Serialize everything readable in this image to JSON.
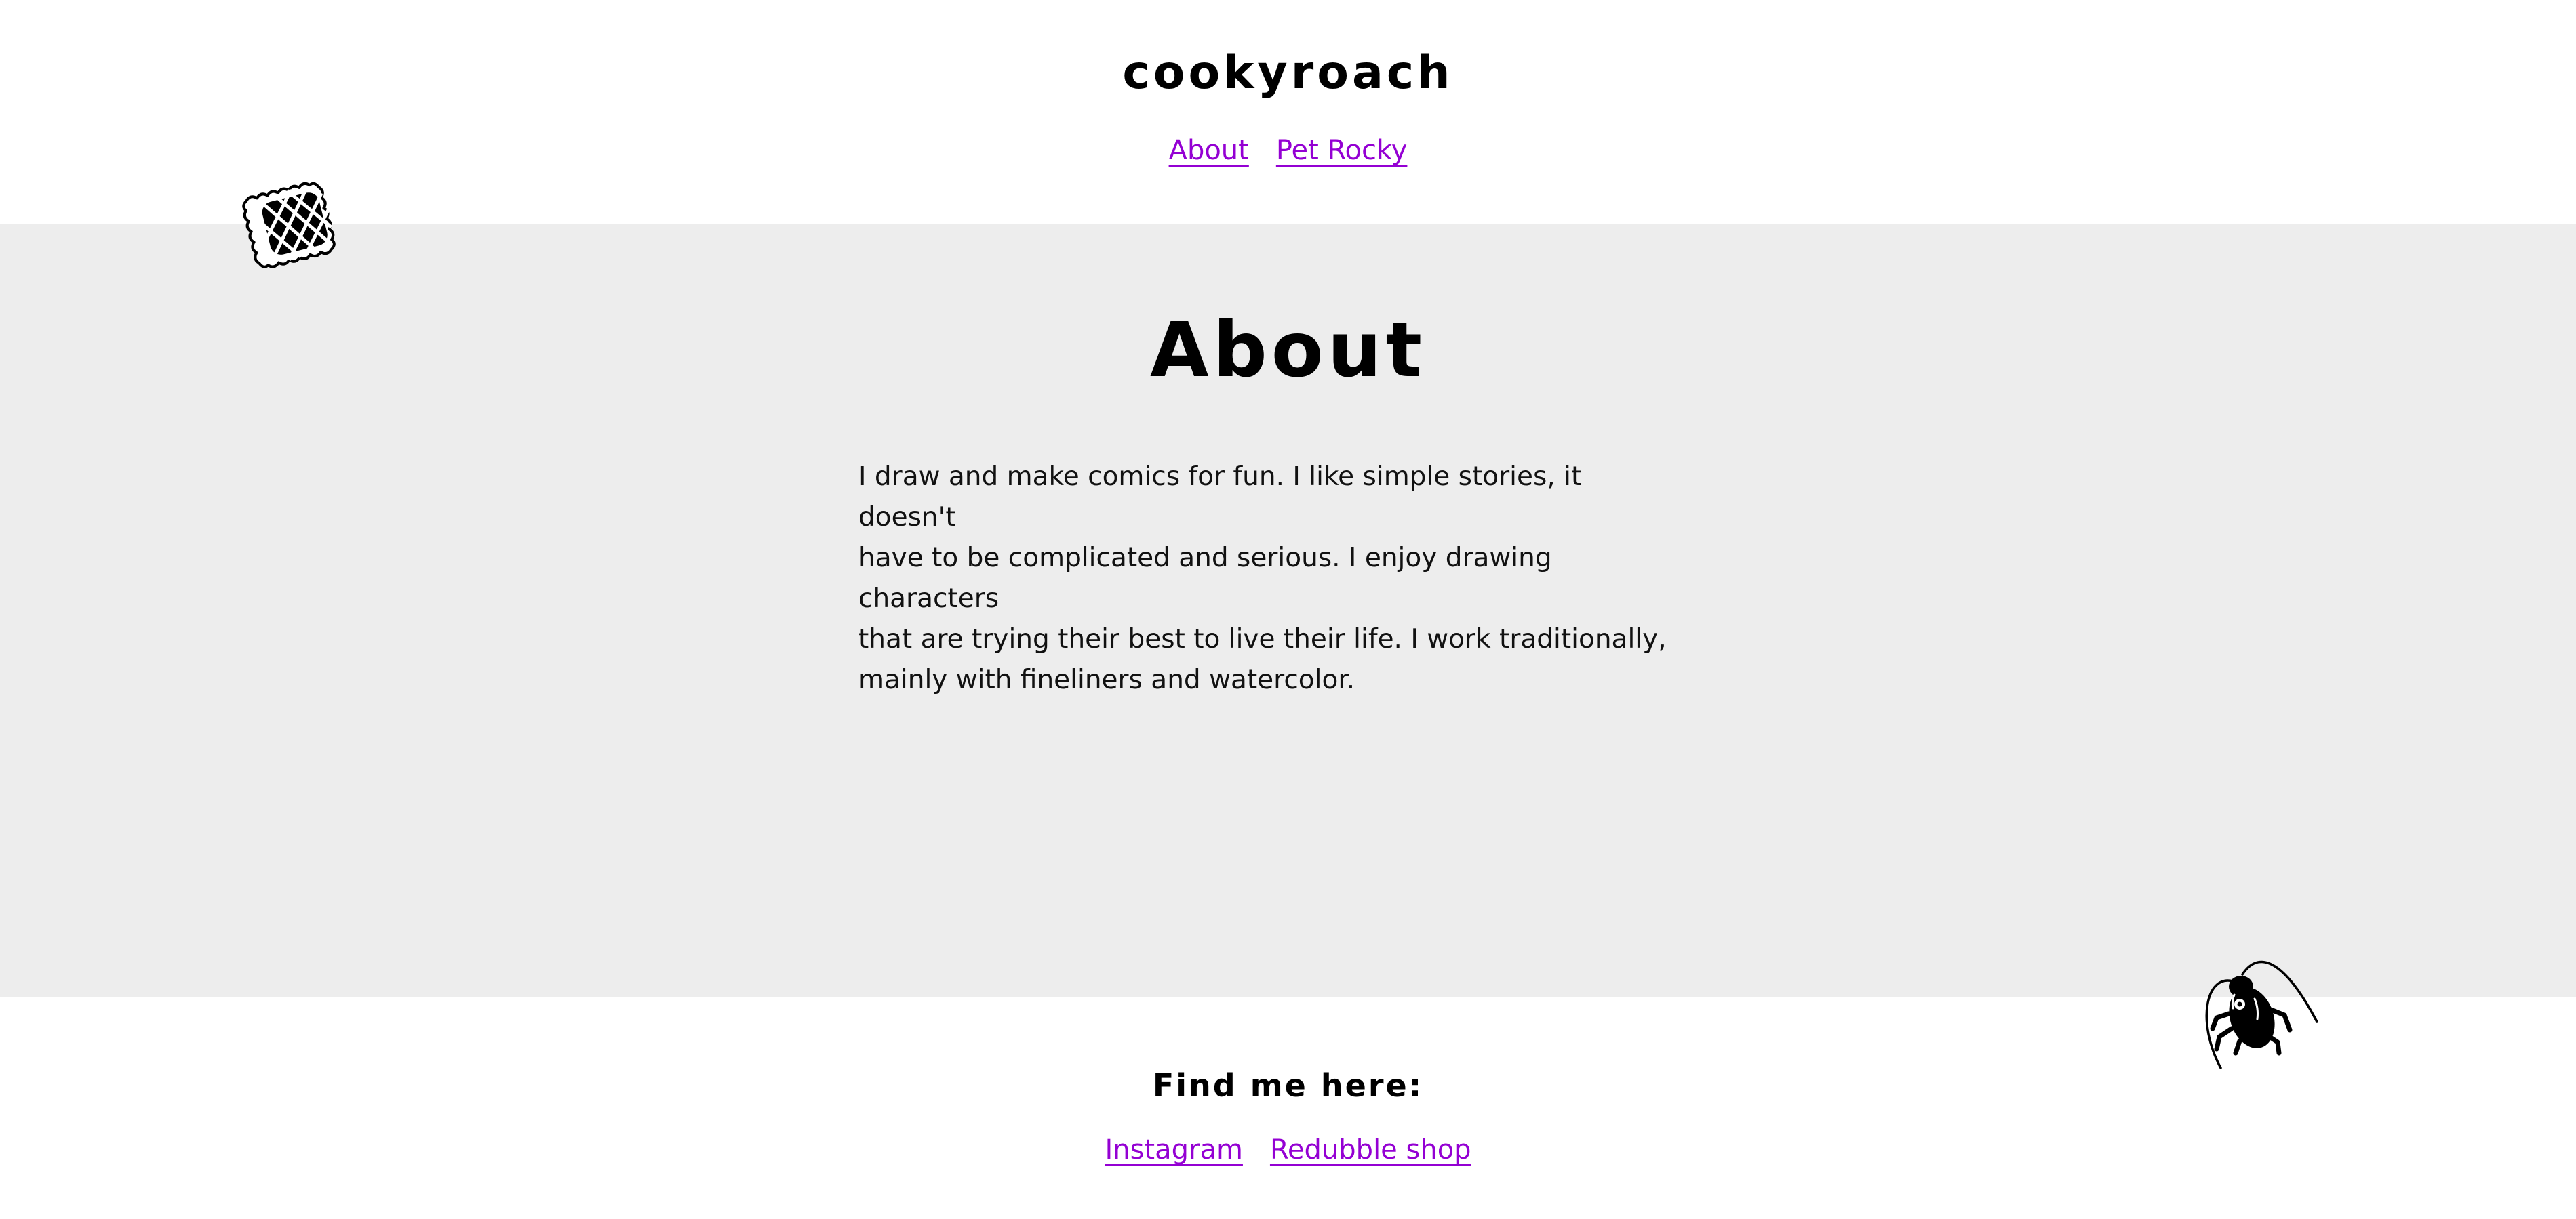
{
  "header": {
    "title": "cookyroach",
    "nav": [
      {
        "label": "About"
      },
      {
        "label": "Pet Rocky"
      }
    ]
  },
  "main": {
    "heading": "About",
    "paragraph_lines": [
      "I draw and make comics for fun. I like simple stories, it doesn't",
      "have to be complicated and serious. I enjoy drawing characters",
      "that are trying their best to live their life. I work traditionally,",
      "mainly with fineliners and watercolor."
    ]
  },
  "footer": {
    "heading": "Find me here:",
    "links": [
      {
        "label": "Instagram"
      },
      {
        "label": "Redubble shop"
      }
    ]
  },
  "decorations": {
    "top_left": "cookie-icon",
    "bottom_right": "cockroach-icon"
  },
  "colors": {
    "link": "#9400d3",
    "band_background": "#ededed",
    "page_background": "#ffffff",
    "text": "#000000"
  }
}
